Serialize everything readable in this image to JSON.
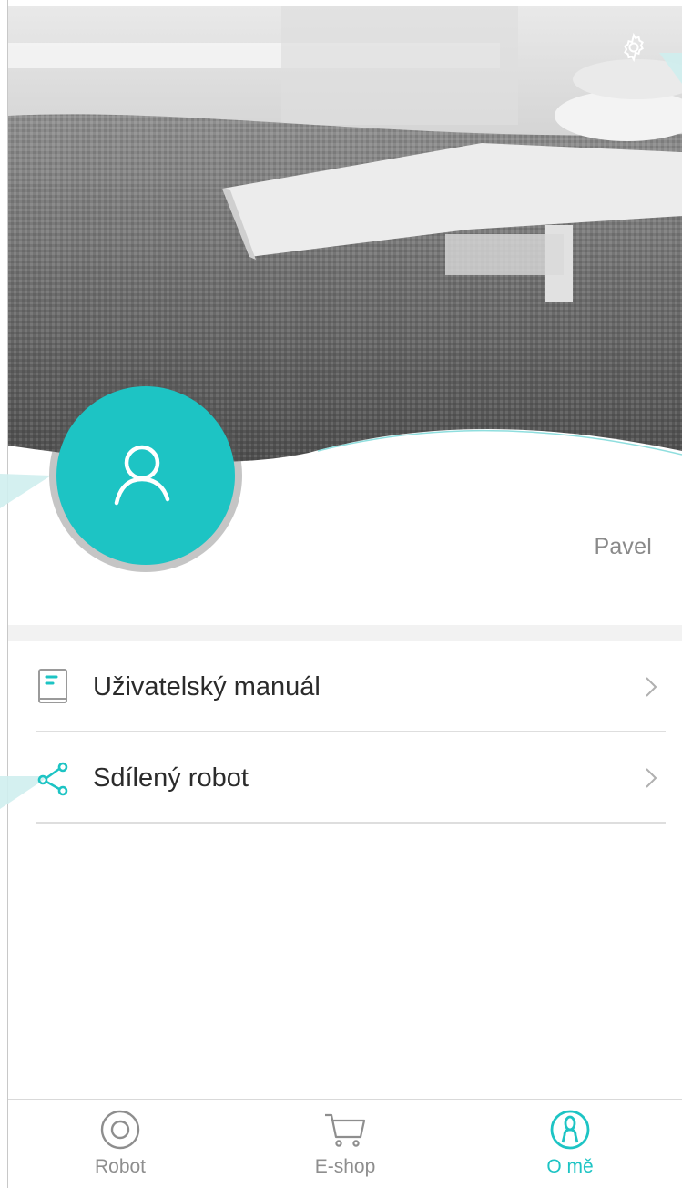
{
  "profile": {
    "username": "Pavel"
  },
  "menu": {
    "items": [
      {
        "label": "Uživatelský manuál",
        "icon": "manual-icon"
      },
      {
        "label": "Sdílený robot",
        "icon": "share-icon"
      }
    ]
  },
  "tabs": [
    {
      "label": "Robot",
      "icon": "robot-icon",
      "active": false
    },
    {
      "label": "E-shop",
      "icon": "cart-icon",
      "active": false
    },
    {
      "label": "O mě",
      "icon": "user-tab-icon",
      "active": true
    }
  ],
  "colors": {
    "accent": "#1dc4c4",
    "text": "#2b2b2b",
    "muted": "#8e8e8e"
  }
}
